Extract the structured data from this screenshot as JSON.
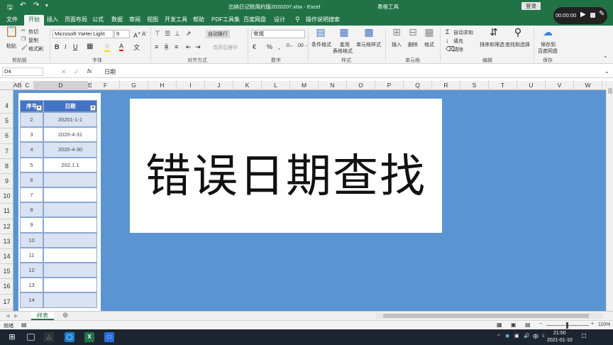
{
  "titlebar": {
    "title": "出纳日记账简约版2020207.xlsx - Excel",
    "context_tab": "表格工具",
    "login_label": "登录"
  },
  "recorder": {
    "time": "00:00:00"
  },
  "tabs": [
    "文件",
    "开始",
    "插入",
    "页面布局",
    "公式",
    "数据",
    "审阅",
    "视图",
    "开发工具",
    "帮助",
    "PDF工具集",
    "百度网盘",
    "设计"
  ],
  "tell_me": "操作说明搜索",
  "ribbon": {
    "paste_label": "粘贴",
    "cut_label": "剪切",
    "copy_label": "复制",
    "format_painter_label": "格式刷",
    "clipboard_group": "剪贴板",
    "font_name": "Microsoft YaHei Light",
    "font_size": "9",
    "font_group": "字体",
    "wrap_text_label": "自动换行",
    "merge_label": "合并后居中",
    "alignment_group": "对齐方式",
    "number_format": "常规",
    "number_group": "数字",
    "conditional_label": "条件格式",
    "table_format_label_1": "套用",
    "table_format_label_2": "表格格式",
    "cell_style_label": "单元格样式",
    "styles_group": "样式",
    "insert_label": "插入",
    "delete_label": "删除",
    "format_label": "格式",
    "cells_group": "单元格",
    "autosum_label": "自动求和",
    "fill_label": "填充",
    "clear_label": "清除",
    "sort_label": "排序和筛选",
    "find_label": "查找和选择",
    "editing_group": "编辑",
    "save_baidu_label_1": "保存到",
    "save_baidu_label_2": "百度网盘",
    "save_group": "保存"
  },
  "formula_bar": {
    "name_box": "D4",
    "fx": "fx",
    "content": "日期"
  },
  "columns": [
    "AB",
    "C",
    "D",
    "E",
    "F",
    "G",
    "H",
    "I",
    "J",
    "K",
    "L",
    "M",
    "N",
    "O",
    "P",
    "Q",
    "R",
    "S",
    "T",
    "U",
    "V",
    "W"
  ],
  "rows": [
    "4",
    "5",
    "6",
    "7",
    "8",
    "9",
    "10",
    "11",
    "12",
    "13",
    "14",
    "15",
    "16",
    "17"
  ],
  "table": {
    "headers": [
      "序号",
      "日期"
    ],
    "rows": [
      [
        "2",
        "20201-1-1"
      ],
      [
        "3",
        "2020-4-31"
      ],
      [
        "4",
        "2020-4-30"
      ],
      [
        "5",
        "202.1.1"
      ],
      [
        "6",
        ""
      ],
      [
        "7",
        ""
      ],
      [
        "8",
        ""
      ],
      [
        "9",
        ""
      ],
      [
        "10",
        ""
      ],
      [
        "11",
        ""
      ],
      [
        "12",
        ""
      ],
      [
        "13",
        ""
      ],
      [
        "14",
        ""
      ]
    ]
  },
  "overlay_title": "错误日期查找",
  "sheet_tab": "样表",
  "status": {
    "ready": "就绪",
    "zoom": "110%"
  },
  "taskbar": {
    "time": "21:50",
    "date": "2021-01-10",
    "ime": "中"
  },
  "colors": {
    "excel_green": "#217346",
    "sheet_bg": "#5b94d2",
    "table_header": "#4472c4"
  }
}
